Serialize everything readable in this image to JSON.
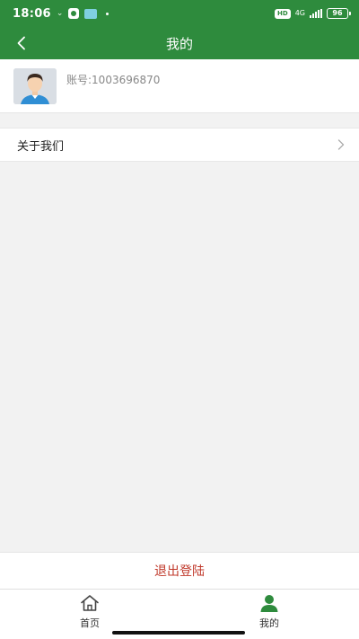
{
  "status_bar": {
    "time": "18:06",
    "network": "4G",
    "hd_label": "HD",
    "battery": "96"
  },
  "header": {
    "title": "我的",
    "back_icon": "chevron-left-icon"
  },
  "profile": {
    "account_text": "账号:1003696870",
    "avatar_icon": "user-avatar"
  },
  "menu": {
    "items": [
      {
        "label": "关于我们",
        "icon": "chevron-right-icon"
      }
    ]
  },
  "logout": {
    "label": "退出登陆",
    "color": "#c0392b"
  },
  "bottom_nav": {
    "items": [
      {
        "label": "首页",
        "icon": "home-icon",
        "active": false
      },
      {
        "label": "我的",
        "icon": "user-icon",
        "active": true
      }
    ]
  },
  "colors": {
    "primary": "#2e8b3d",
    "background": "#f2f2f2"
  }
}
